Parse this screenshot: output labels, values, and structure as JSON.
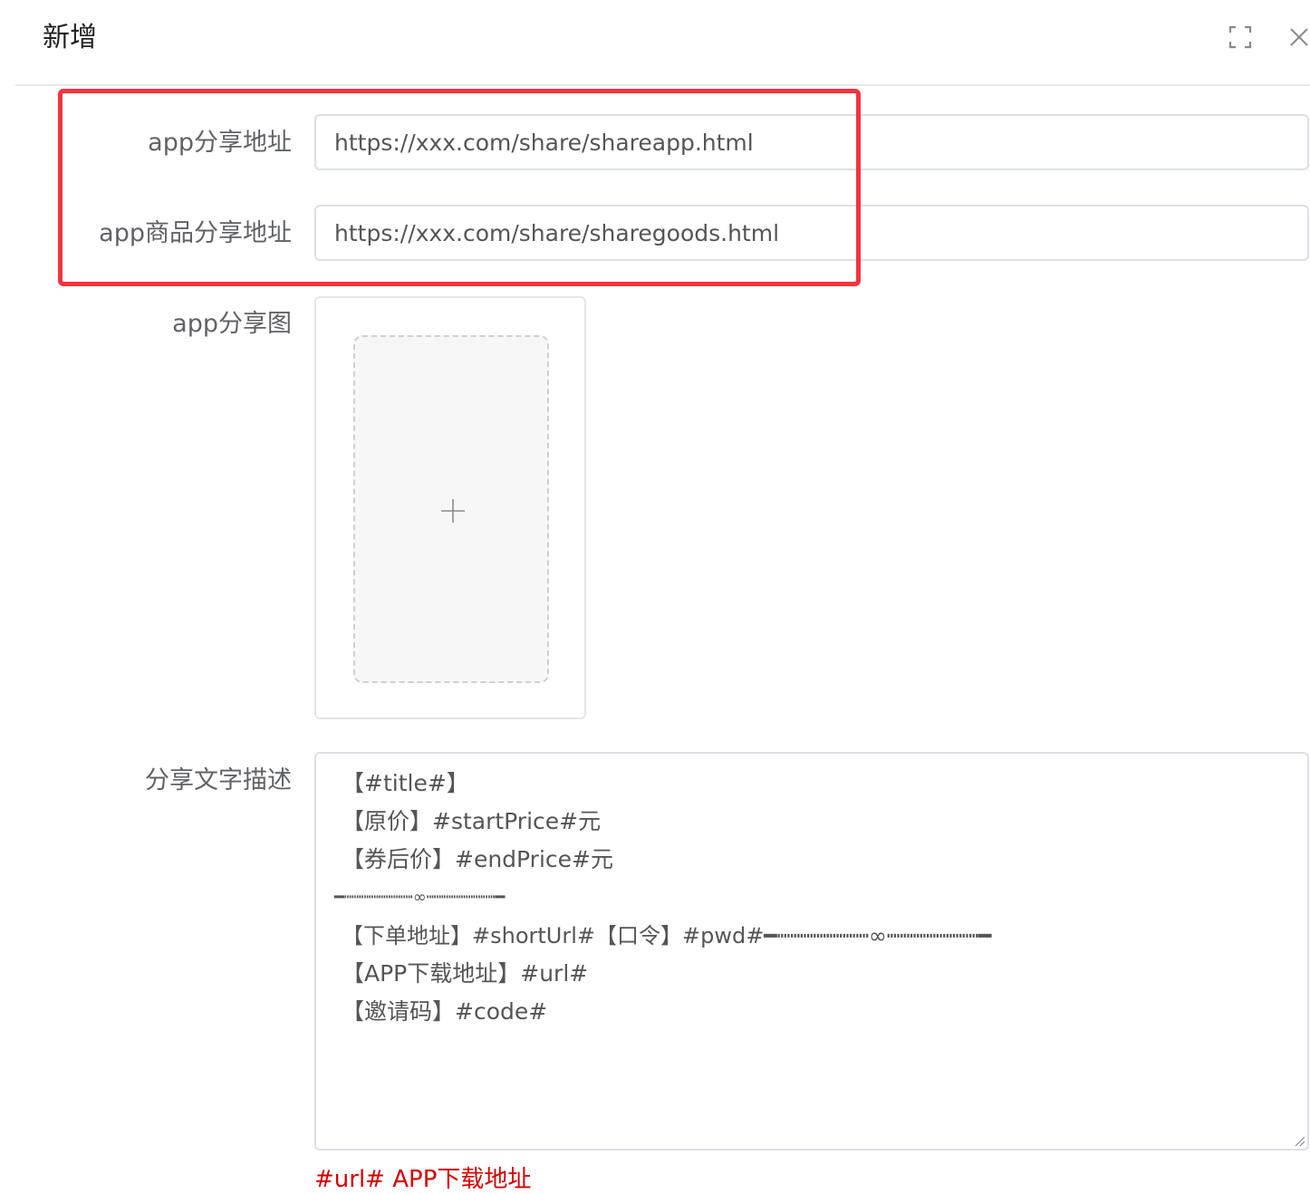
{
  "dialog": {
    "title": "新增",
    "fullscreen_icon": "fullscreen-icon",
    "close_icon": "close-icon"
  },
  "form": {
    "share_url": {
      "label": "app分享地址",
      "value": "https://xxx.com/share/shareapp.html"
    },
    "goods_share_url": {
      "label": "app商品分享地址",
      "value": "https://xxx.com/share/sharegoods.html"
    },
    "share_image": {
      "label": "app分享图",
      "upload_icon": "plus-icon"
    },
    "share_text": {
      "label": "分享文字描述",
      "lines": [
        "【#title#】",
        "【原价】#startPrice#元",
        "【券后价】#endPrice#元",
        "━┉┉┉┉┉┉┉∞┉┉┉┉┉┉┉━",
        "【下单地址】#shortUrl#【口令】#pwd#━┉┉┉┉┉┉┉∞┉┉┉┉┉┉┉━",
        "【APP下载地址】#url#",
        "【邀请码】#code#"
      ],
      "hint": "#url# APP下载地址"
    }
  },
  "colors": {
    "highlight_border": "#f5333f",
    "hint_text": "#d40000"
  }
}
